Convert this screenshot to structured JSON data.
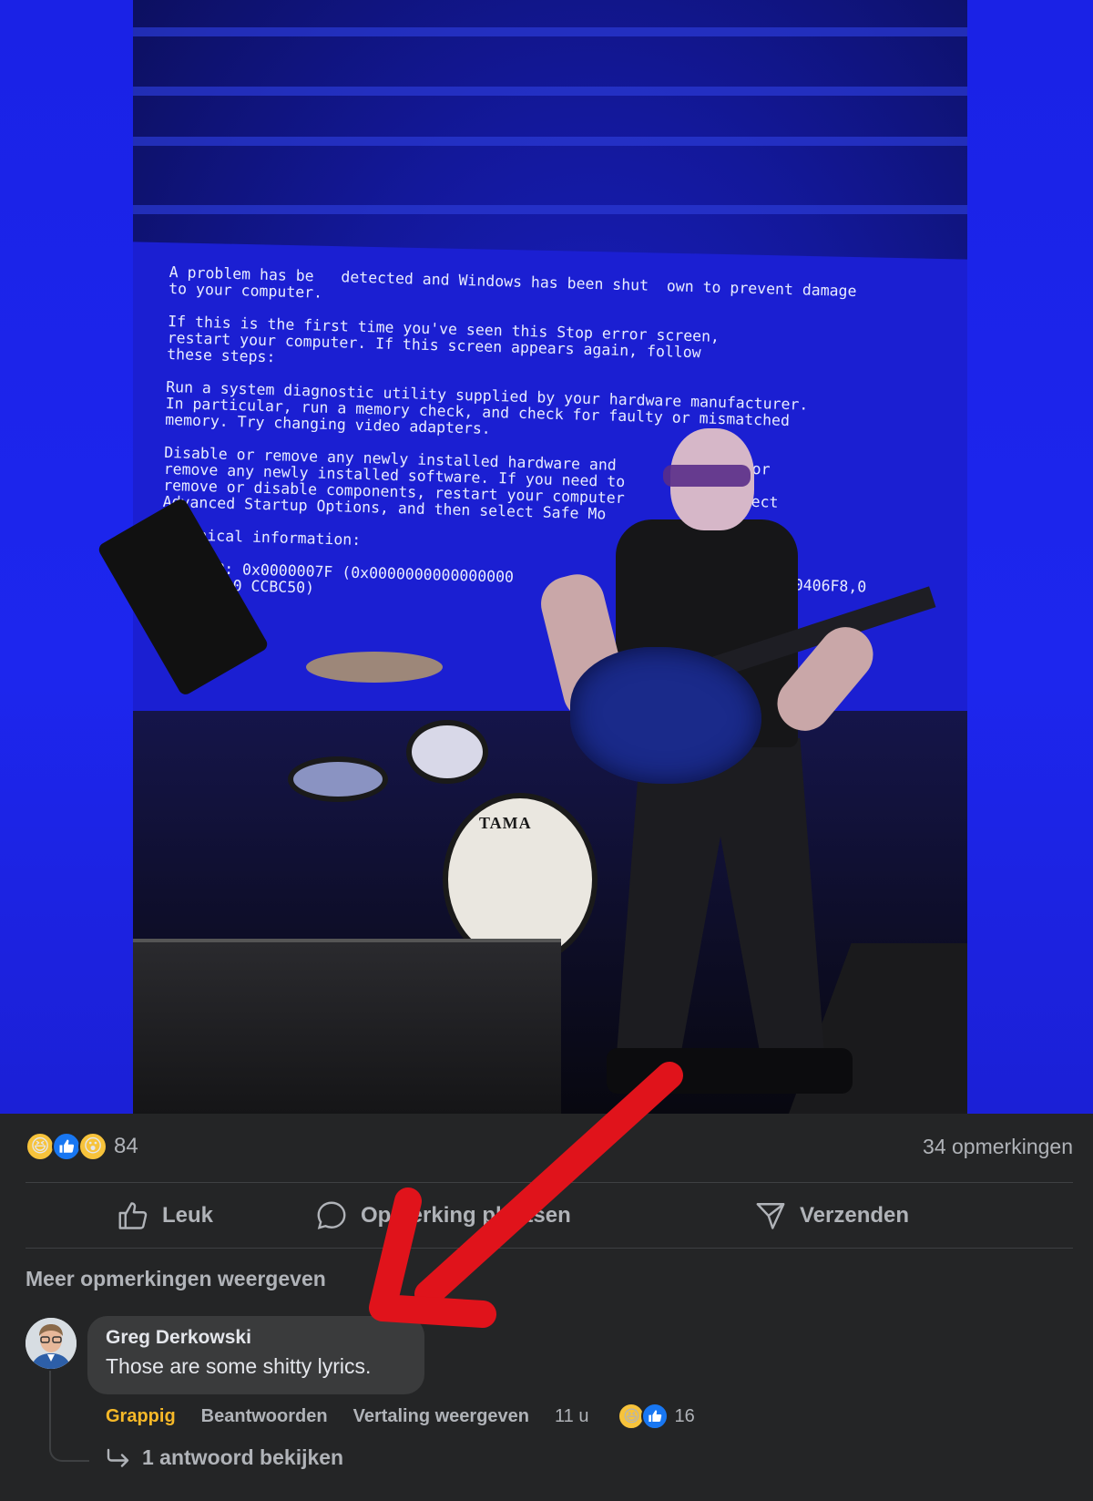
{
  "photo": {
    "bsod_lines": [
      "A problem has be   detected and Windows has been shut  own to prevent damage",
      "to your computer.",
      "",
      "If this is the first time you've seen this Stop error screen,",
      "restart your computer. If this screen appears again, follow",
      "these steps:",
      "",
      "Run a system diagnostic utility supplied by your hardware manufacturer.",
      "In particular, run a memory check, and check for faulty or mismatched",
      "memory. Try changing video adapters.",
      "",
      "Disable or remove any newly installed hardware and        isable or",
      "remove any newly installed software. If you need to       Mode to",
      "remove or disable components, restart your computer      3 to select",
      "Advanced Startup Options, and then select Safe Mo",
      "",
      "Technical information:",
      "",
      "** STOP: 0x0000007F (0x0000000000000000                    0x0000000000406F8,0",
      "  FFF8000 CCBC50)"
    ],
    "drum_brand": "TAMA"
  },
  "post": {
    "reaction_count": "84",
    "comment_count": "34 opmerkingen",
    "actions": {
      "like": "Leuk",
      "comment": "Opmerking plaatsen",
      "send": "Verzenden"
    },
    "more_comments": "Meer opmerkingen weergeven"
  },
  "comment": {
    "author": "Greg Derkowski",
    "text": "Those are some shitty lyrics.",
    "reaction_label": "Grappig",
    "reply_label": "Beantwoorden",
    "translate_label": "Vertaling weergeven",
    "time": "11 u",
    "reaction_count": "16",
    "replies_label": "1 antwoord bekijken"
  },
  "colors": {
    "background": "#242526",
    "secondary_text": "#b0b3b8",
    "primary_text": "#e4e6eb",
    "funny_accent": "#f7b928",
    "like_blue": "#1877f2",
    "annotation_arrow": "#e0131b"
  },
  "icons": [
    "haha-emoji-icon",
    "like-emoji-icon",
    "wow-emoji-icon",
    "thumbs-up-icon",
    "comment-bubble-icon",
    "send-icon",
    "reply-arrow-icon"
  ]
}
